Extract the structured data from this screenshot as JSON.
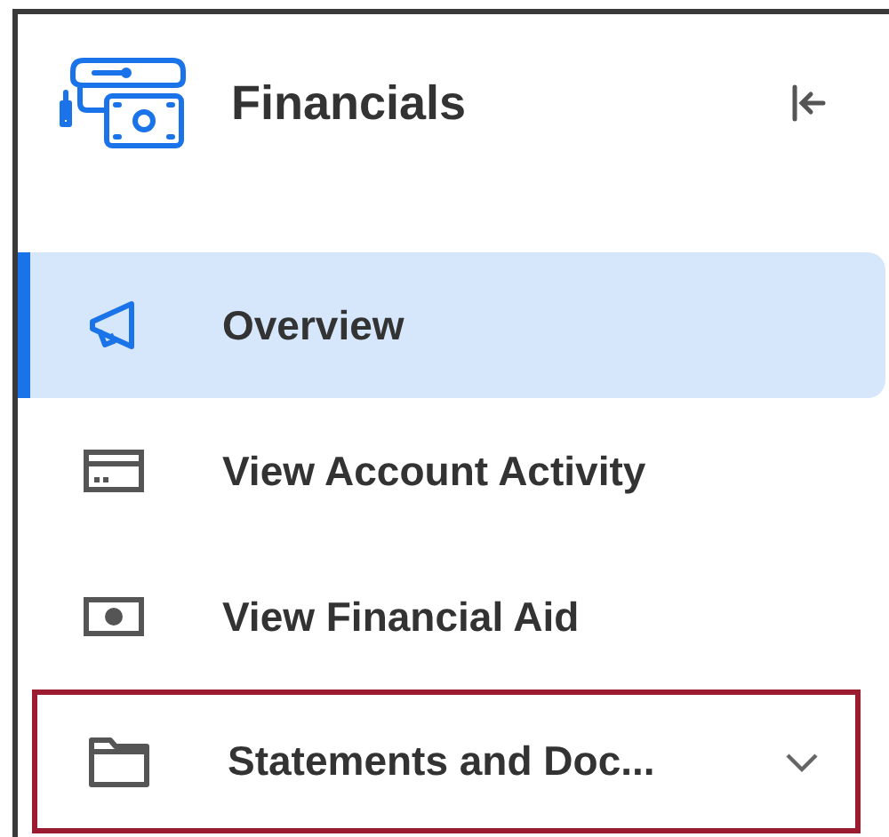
{
  "header": {
    "title": "Financials"
  },
  "nav": [
    {
      "label": "Overview",
      "kind": "link",
      "selected": true,
      "highlighted": false
    },
    {
      "label": "View Account Activity",
      "kind": "link",
      "selected": false,
      "highlighted": false
    },
    {
      "label": "View Financial Aid",
      "kind": "link",
      "selected": false,
      "highlighted": false
    },
    {
      "label": "Statements and Doc...",
      "kind": "group",
      "selected": false,
      "highlighted": true
    }
  ]
}
